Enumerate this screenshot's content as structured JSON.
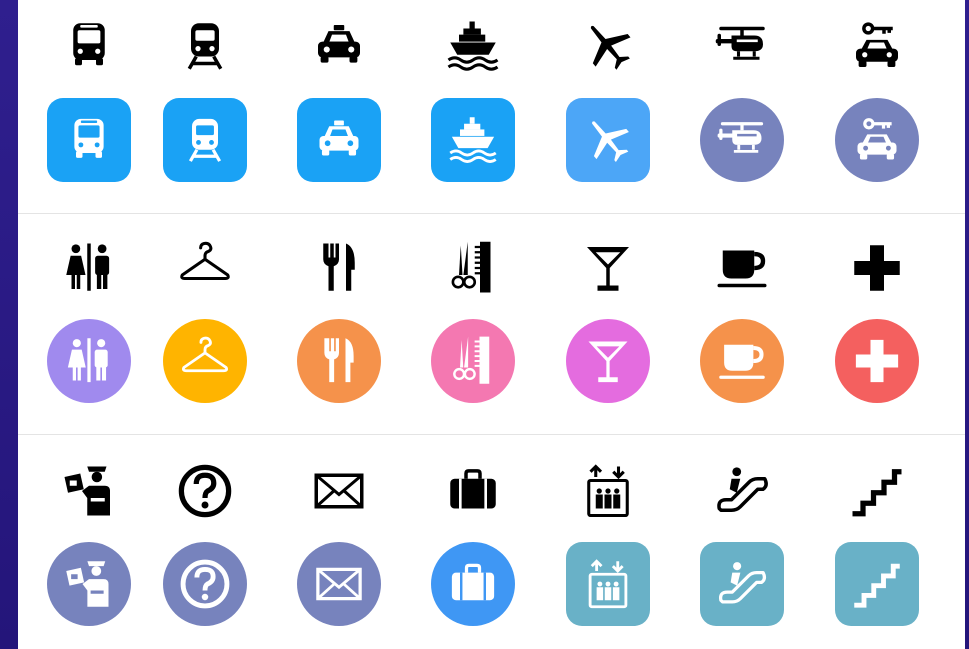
{
  "sheet": {
    "background": "#ffffff",
    "frame": "#2a1a86"
  },
  "rows": [
    {
      "items": [
        {
          "icon": "bus-icon",
          "shape": "square",
          "color": "#1aa2f5"
        },
        {
          "icon": "train-icon",
          "shape": "square",
          "color": "#1aa2f5"
        },
        {
          "icon": "taxi-icon",
          "shape": "square",
          "color": "#1aa2f5"
        },
        {
          "icon": "ship-icon",
          "shape": "square",
          "color": "#1aa2f5"
        },
        {
          "icon": "airplane-icon",
          "shape": "square",
          "color": "#4ca6f7"
        },
        {
          "icon": "helicopter-icon",
          "shape": "round",
          "color": "#7783bd"
        },
        {
          "icon": "car-rental-icon",
          "shape": "round",
          "color": "#7783bd"
        }
      ]
    },
    {
      "items": [
        {
          "icon": "restroom-icon",
          "shape": "round",
          "color": "#a08aee"
        },
        {
          "icon": "coat-hanger-icon",
          "shape": "round",
          "color": "#ffb400"
        },
        {
          "icon": "restaurant-icon",
          "shape": "round",
          "color": "#f5924b"
        },
        {
          "icon": "barber-icon",
          "shape": "round",
          "color": "#f478b1"
        },
        {
          "icon": "cocktail-icon",
          "shape": "round",
          "color": "#e46cdf"
        },
        {
          "icon": "coffee-icon",
          "shape": "round",
          "color": "#f5924b"
        },
        {
          "icon": "first-aid-icon",
          "shape": "round",
          "color": "#f4605f"
        }
      ]
    },
    {
      "items": [
        {
          "icon": "customs-officer-icon",
          "shape": "round",
          "color": "#7783bd"
        },
        {
          "icon": "information-question-icon",
          "shape": "round",
          "color": "#7783bd"
        },
        {
          "icon": "mail-icon",
          "shape": "round",
          "color": "#7783bd"
        },
        {
          "icon": "baggage-icon",
          "shape": "round",
          "color": "#3f97f4"
        },
        {
          "icon": "elevator-icon",
          "shape": "square",
          "color": "#69b1c7"
        },
        {
          "icon": "escalator-icon",
          "shape": "square",
          "color": "#69b1c7"
        },
        {
          "icon": "stairs-icon",
          "shape": "square",
          "color": "#69b1c7"
        }
      ]
    }
  ]
}
